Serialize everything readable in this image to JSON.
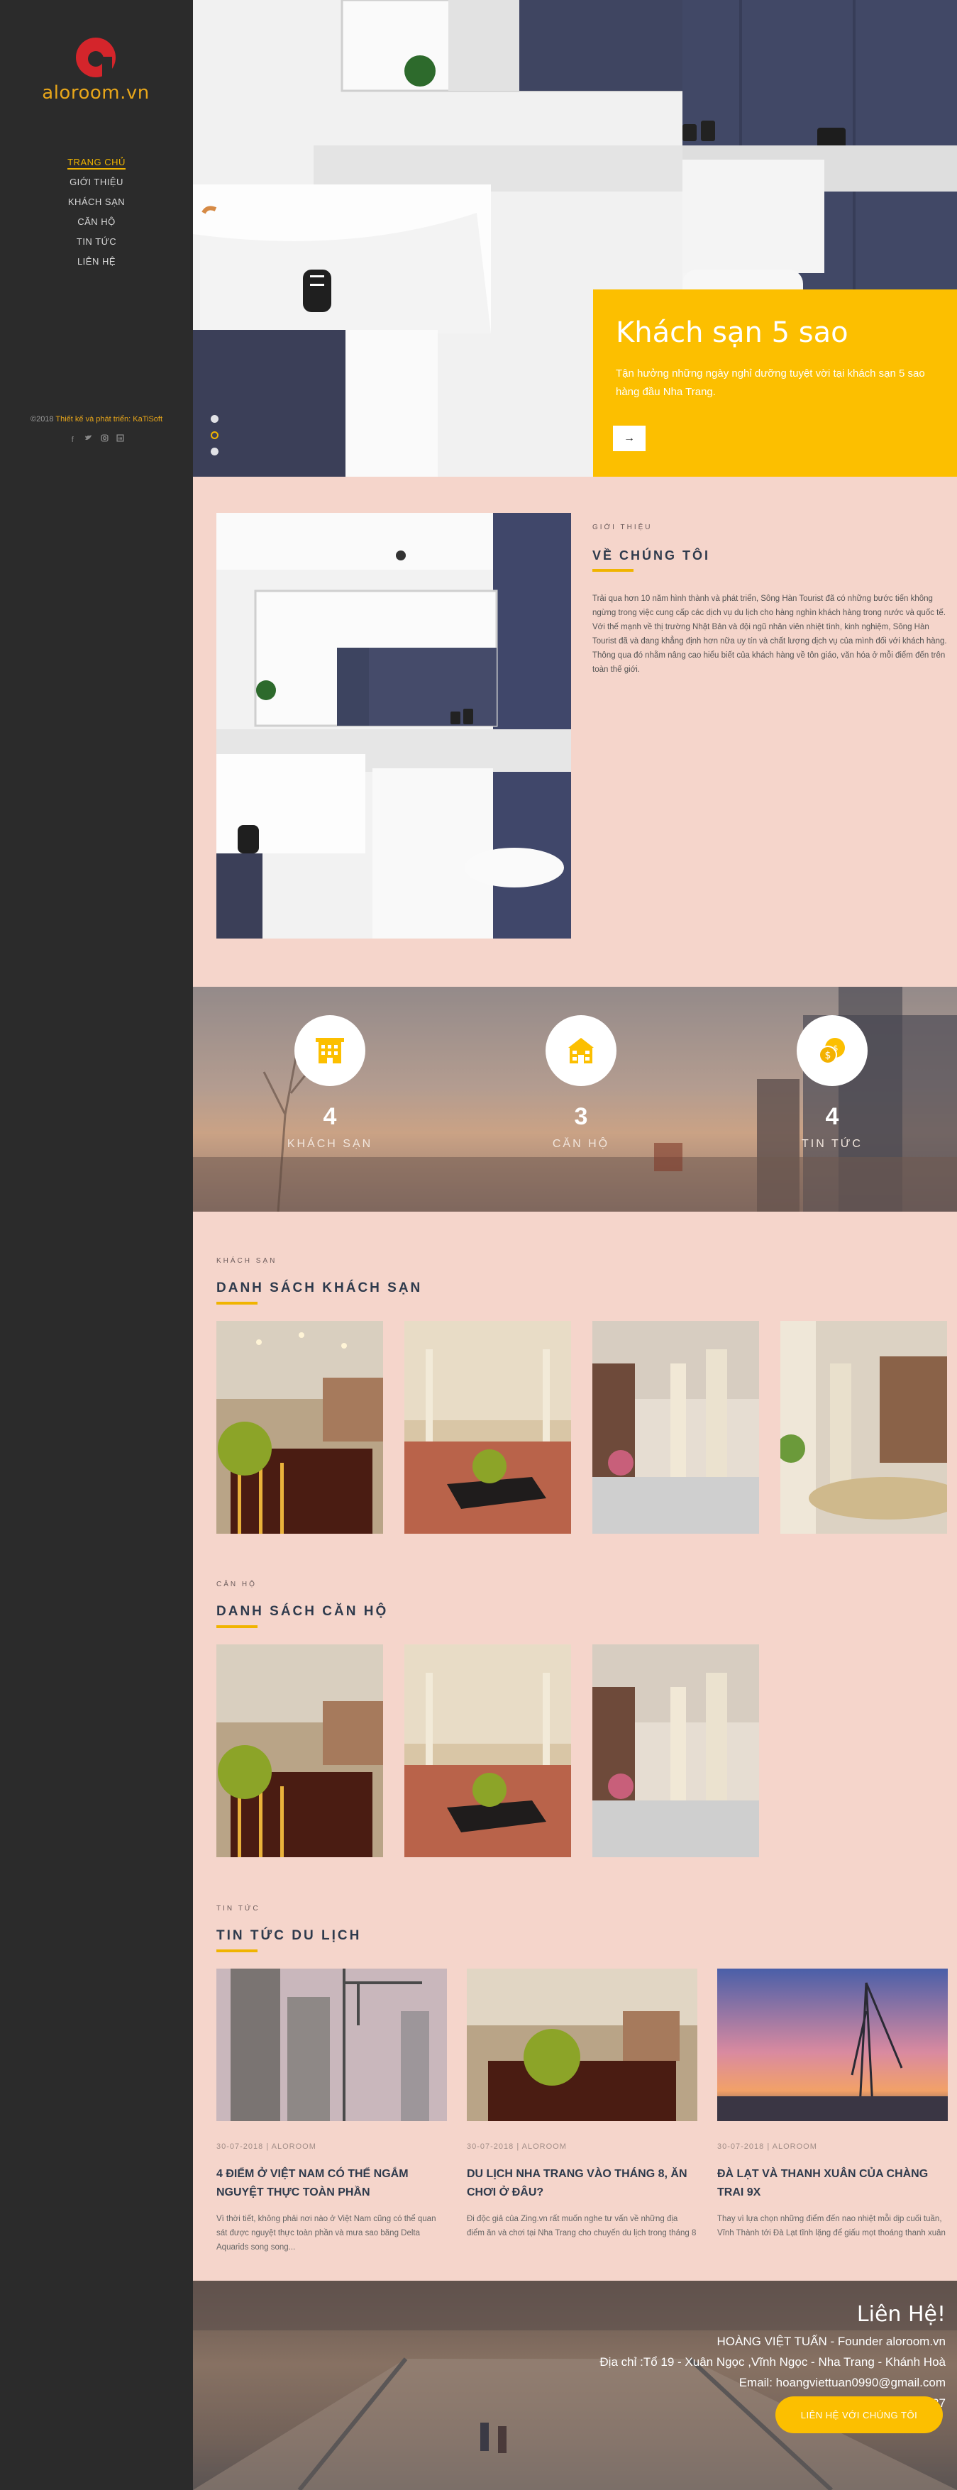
{
  "brand": {
    "logo_text": "aloroom.vn",
    "accent": "#f0b400",
    "logo_red": "#d4252b"
  },
  "nav": {
    "items": [
      {
        "label": "TRANG CHỦ",
        "active": true
      },
      {
        "label": "GIỚI THIỆU"
      },
      {
        "label": "KHÁCH SẠN"
      },
      {
        "label": "CĂN HỘ"
      },
      {
        "label": "TIN TỨC"
      },
      {
        "label": "LIÊN HỆ"
      }
    ]
  },
  "credit": {
    "year": "©2018",
    "text": "Thiết kế và phát triển: KaTiSoft"
  },
  "social": [
    "facebook-icon",
    "twitter-icon",
    "instagram-icon",
    "linkedin-icon"
  ],
  "hero": {
    "title": "Khách sạn 5 sao",
    "description": "Tận hưởng những ngày nghỉ dưỡng tuyệt vời tại khách sạn 5 sao hàng đầu Nha Trang.",
    "button_icon": "→",
    "slide_count": 3,
    "active_slide": 2
  },
  "about": {
    "kicker": "GIỚI THIỆU",
    "title": "VỀ CHÚNG TÔI",
    "body": "Trải qua hơn 10 năm hình thành và phát triển, Sông Hàn Tourist đã có những bước tiến không ngừng trong việc cung cấp các dịch vụ du lịch cho hàng nghìn khách hàng trong nước và quốc tế. Với thế mạnh về thị trường Nhật Bản và đội ngũ nhân viên nhiệt tình, kinh nghiệm, Sông Hàn Tourist đã và đang khẳng định hơn nữa uy tín và chất lượng dịch vụ của mình đối với khách hàng. Thông qua đó nhằm nâng cao hiểu biết của khách hàng về tôn giáo, văn hóa ở mỗi điểm đến trên toàn thế giới."
  },
  "stats": [
    {
      "value": "4",
      "label": "KHÁCH SẠN",
      "icon": "hotel-icon"
    },
    {
      "value": "3",
      "label": "CĂN HỘ",
      "icon": "apartment-icon"
    },
    {
      "value": "4",
      "label": "TIN TỨC",
      "icon": "news-coins-icon"
    }
  ],
  "hotels": {
    "kicker": "KHÁCH SẠN",
    "title": "DANH SÁCH KHÁCH SẠN",
    "count": 4
  },
  "apartments": {
    "kicker": "CĂN HỘ",
    "title": "DANH SÁCH CĂN HỘ",
    "count": 3
  },
  "news": {
    "kicker": "TIN TỨC",
    "title": "TIN TỨC DU LỊCH",
    "items": [
      {
        "meta": "30-07-2018 | ALOROOM",
        "title": "4 ĐIỂM Ở VIỆT NAM CÓ THỂ NGẮM NGUYỆT THỰC TOÀN PHẦN",
        "excerpt": "Vì thời tiết, không phải nơi nào ở Việt Nam cũng có thể quan sát được nguyệt thực toàn phần và mưa sao băng Delta Aquarids song song..."
      },
      {
        "meta": "30-07-2018 | ALOROOM",
        "title": "DU LỊCH NHA TRANG VÀO THÁNG 8, ĂN CHƠI Ở ĐÂU?",
        "excerpt": "Đi độc giả của Zing.vn rất muốn nghe tư vấn về những địa điểm ăn và chơi tại Nha Trang cho chuyến du lịch trong tháng 8"
      },
      {
        "meta": "30-07-2018 | ALOROOM",
        "title": "ĐÀ LẠT VÀ THANH XUÂN CỦA CHÀNG TRAI 9X",
        "excerpt": "Thay vì lựa chọn những điểm đến nao nhiệt mỗi dịp cuối tuần, Vĩnh Thành tới Đà Lạt tĩnh lặng để giấu mọt thoáng thanh xuân"
      }
    ]
  },
  "contact": {
    "title": "Liên Hệ!",
    "lines": [
      "HOÀNG VIỆT TUẤN - Founder aloroom.vn",
      "Địa chỉ :Tổ 19 - Xuân Ngọc ,Vĩnh Ngọc - Nha Trang - Khánh Hoà",
      "Email: hoangviettuan0990@gmail.com",
      "Điện thoại : 0969.305.137"
    ],
    "button": "LIÊN HỆ VỚI CHÚNG TÔI"
  }
}
